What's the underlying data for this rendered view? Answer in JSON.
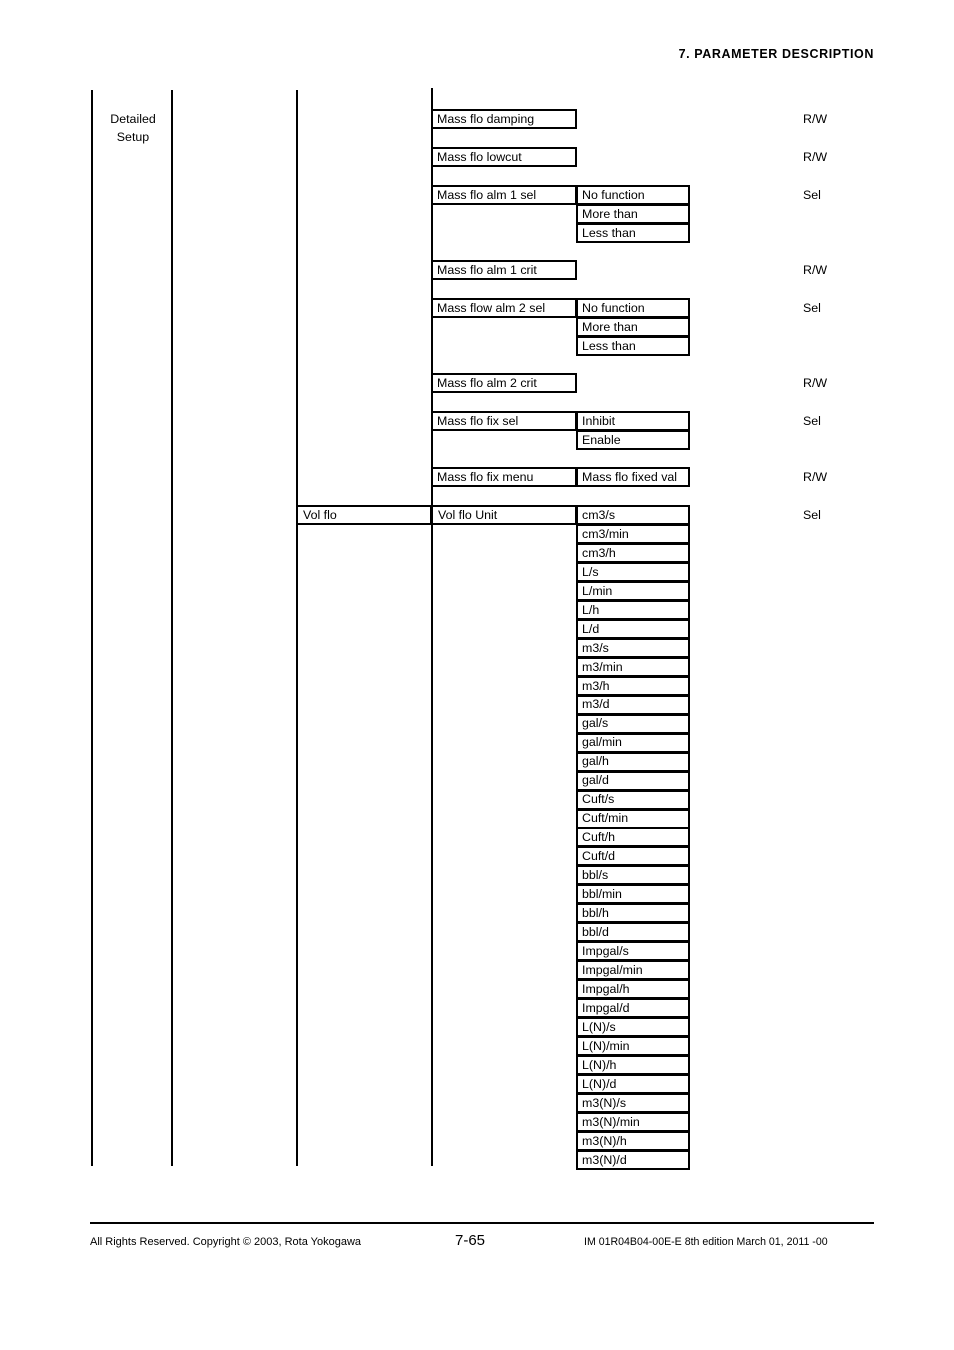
{
  "page": {
    "header": "7.  PARAMETER DESCRIPTION",
    "number": "7-65"
  },
  "footer": {
    "copyright": "All Rights Reserved. Copyright © 2003, Rota Yokogawa",
    "page_number": "7-65",
    "document_id": "IM 01R04B04-00E-E  8th edition March 01, 2011 -00"
  },
  "menu": {
    "level1_label_line1": "Detailed",
    "level1_label_line2": "Setup",
    "mass_flo_params": [
      {
        "name": "Mass flo damping",
        "access": "R/W",
        "values": []
      },
      {
        "name": "Mass flo lowcut",
        "access": "R/W",
        "values": []
      },
      {
        "name": "Mass flo alm 1 sel",
        "access": "Sel",
        "values": [
          "No function",
          "More than",
          "Less than"
        ]
      },
      {
        "name": "Mass flo alm 1 crit",
        "access": "R/W",
        "values": []
      },
      {
        "name": "Mass flow alm 2 sel",
        "access": "Sel",
        "values": [
          "No function",
          "More than",
          "Less than"
        ]
      },
      {
        "name": "Mass flo alm 2 crit",
        "access": "R/W",
        "values": []
      },
      {
        "name": "Mass flo fix sel",
        "access": "Sel",
        "values": [
          "Inhibit",
          "Enable"
        ]
      },
      {
        "name": "Mass flo fix menu",
        "access": "R/W",
        "values": [
          "Mass flo fixed val"
        ]
      }
    ],
    "vol_flo": {
      "group_label": "Vol flo",
      "parameter_label": "Vol flo Unit",
      "access": "Sel",
      "units": [
        "cm3/s",
        "cm3/min",
        "cm3/h",
        "L/s",
        "L/min",
        "L/h",
        "L/d",
        "m3/s",
        "m3/min",
        "m3/h",
        "m3/d",
        "gal/s",
        "gal/min",
        "gal/h",
        "gal/d",
        "Cuft/s",
        "Cuft/min",
        "Cuft/h",
        "Cuft/d",
        "bbl/s",
        "bbl/min",
        "bbl/h",
        "bbl/d",
        "Impgal/s",
        "Impgal/min",
        "Impgal/h",
        "Impgal/d",
        "L(N)/s",
        "L(N)/min",
        "L(N)/h",
        "L(N)/d",
        "m3(N)/s",
        "m3(N)/min",
        "m3(N)/h",
        "m3(N)/d"
      ]
    }
  }
}
